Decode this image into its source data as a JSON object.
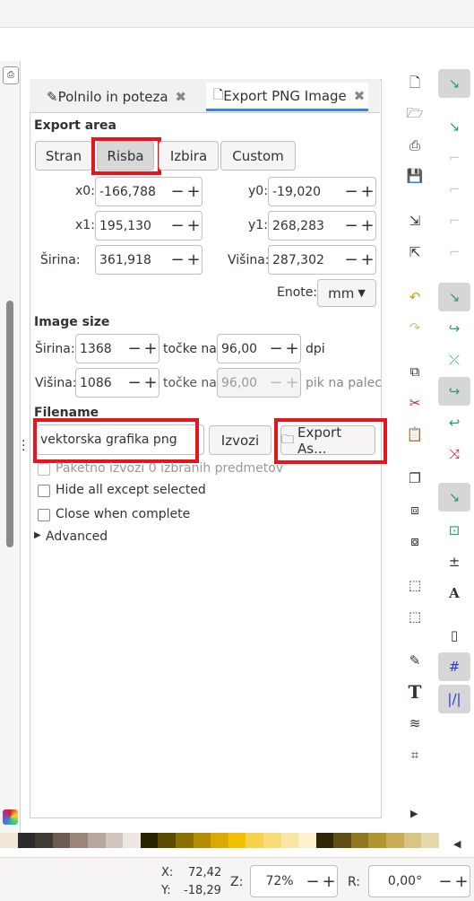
{
  "tabs": [
    {
      "label": "Polnilo in poteza"
    },
    {
      "label": "Export PNG Image"
    }
  ],
  "export_area": {
    "title": "Export area",
    "buttons": [
      "Stran",
      "Risba",
      "Izbira",
      "Custom"
    ],
    "x0_label": "x0:",
    "x0": "-166,788",
    "y0_label": "y0:",
    "y0": "-19,020",
    "x1_label": "x1:",
    "x1": "195,130",
    "y1_label": "y1:",
    "y1": "268,283",
    "width_label": "Širina:",
    "width": "361,918",
    "height_label": "Višina:",
    "height": "287,302",
    "units_label": "Enote:",
    "units": "mm"
  },
  "image_size": {
    "title": "Image size",
    "width_label": "Širina:",
    "width": "1368",
    "at_label": "točke na",
    "dpi_value": "96,00",
    "dpi_label": "dpi",
    "height_label": "Višina:",
    "height": "1086",
    "at_label2": "točke na",
    "dpi_value2": "96,00",
    "dpi_label2": "pik na palec"
  },
  "filename": {
    "title": "Filename",
    "value": "vektorska grafika png",
    "export_button": "Izvozi",
    "export_as_button": "Export As..."
  },
  "options": {
    "batch": "Paketno izvozi 0 izbranih predmetov",
    "hide_all": "Hide all except selected",
    "close_when_complete": "Close when complete",
    "advanced": "Advanced"
  },
  "status": {
    "x_label": "X:",
    "x": "72,42",
    "y_label": "Y:",
    "y": "-18,29",
    "z_label": "Z:",
    "zoom": "72%",
    "r_label": "R:",
    "rotation": "0,00°"
  },
  "palette": [
    "#f2e6d8",
    "#2b2b2b",
    "#3f3a36",
    "#6b5d52",
    "#9b857a",
    "#b6a89e",
    "#d2c6be",
    "#ede7e2",
    "#2a2300",
    "#5a4a00",
    "#8a7000",
    "#b38f00",
    "#d9ab00",
    "#f2c200",
    "#f6d24a",
    "#f8dc78",
    "#fae6a3",
    "#fcf0cf",
    "#2e2608",
    "#5f4f14",
    "#8f7820",
    "#b09530",
    "#c7ad55",
    "#d9c583",
    "#e6d9ab"
  ]
}
